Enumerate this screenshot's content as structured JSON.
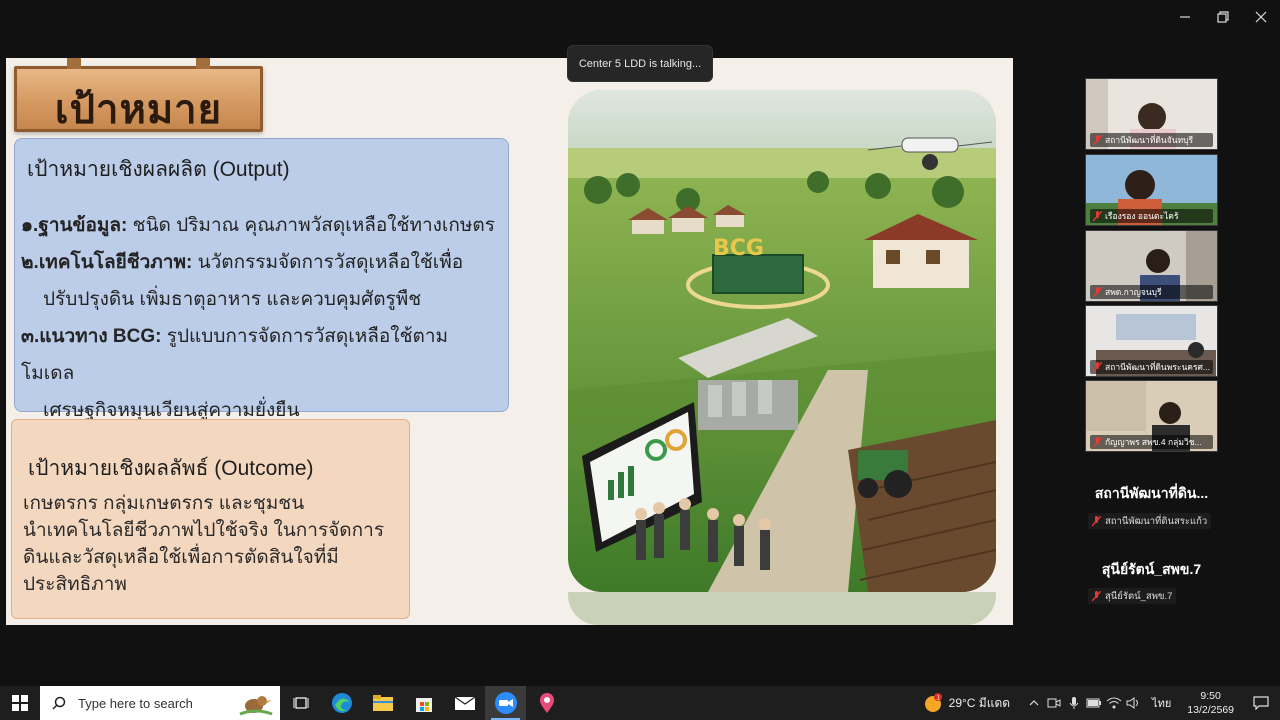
{
  "status": {
    "talking": "Center 5 LDD is talking..."
  },
  "slide": {
    "title": "เป้าหมาย",
    "output": {
      "heading": "เป้าหมายเชิงผลผลิต (Output)",
      "items": [
        {
          "num": "๑.",
          "label": "ฐานข้อมูล:",
          "text": " ชนิด ปริมาณ คุณภาพวัสดุเหลือใช้ทางเกษตร"
        },
        {
          "num": "๒.",
          "label": "เทคโนโลยีชีวภาพ:",
          "text": " นวัตกรรมจัดการวัสดุเหลือใช้เพื่อ",
          "cont": "ปรับปรุงดิน เพิ่มธาตุอาหาร และควบคุมศัตรูพืช"
        },
        {
          "num": "๓.",
          "label": "แนวทาง BCG:",
          "text": " รูปแบบการจัดการวัสดุเหลือใช้ตามโมเดล",
          "cont": "เศรษฐกิจหมุนเวียนสู่ความยั่งยืน"
        }
      ]
    },
    "outcome": {
      "heading": "เป้าหมายเชิงผลลัพธ์ (Outcome)",
      "lines": [
        "เกษตรกร กลุ่มเกษตรกร และชุมชน",
        "นำเทคโนโลยีชีวภาพไปใช้จริง ในการจัดการ",
        "ดินและวัสดุเหลือใช้เพื่อการตัดสินใจที่มี",
        "ประสิทธิภาพ"
      ]
    },
    "photo": {
      "sign_text": "BCG"
    }
  },
  "participants": {
    "tiles": [
      {
        "name": "สถานีพัฒนาที่ดินจันทบุรี"
      },
      {
        "name": "เรืองรอง ออนตะไคร้"
      },
      {
        "name": "สพด.กาญจนบุรี"
      },
      {
        "name": "สถานีพัฒนาที่ดินพระนครศ..."
      },
      {
        "name": "กัญญาพร สพข.4 กลุ่มวิช..."
      }
    ],
    "named": [
      {
        "title": "สถานีพัฒนาที่ดิน...",
        "sub": "สถานีพัฒนาที่ดินสระแก้ว"
      },
      {
        "title": "สุนีย์รัตน์_สพข.7",
        "sub": "สุนีย์รัตน์_สพข.7"
      }
    ]
  },
  "taskbar": {
    "search_placeholder": "Type here to search",
    "weather": "29°C มีแดด",
    "weather_badge": "1",
    "lang": "ไทย",
    "time": "9:50",
    "date": "13/2/2569"
  },
  "colors": {
    "output_bg": "#bccde9",
    "outcome_bg": "#f4d7bf",
    "mute_red": "#e53935"
  }
}
